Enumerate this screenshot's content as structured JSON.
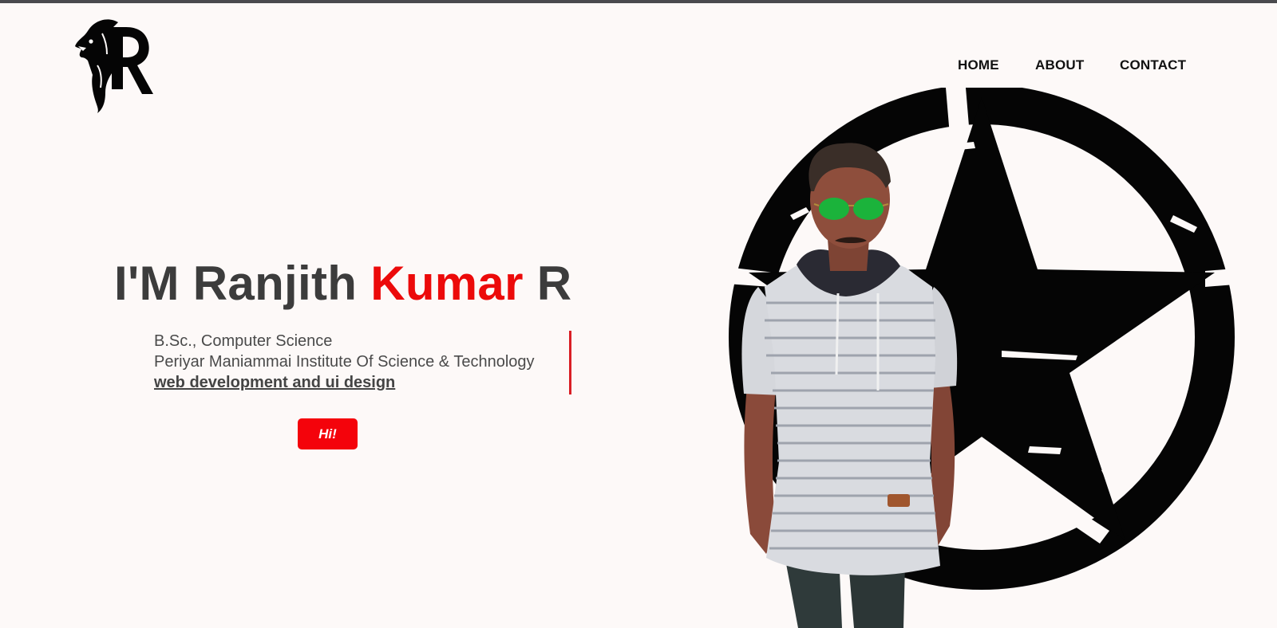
{
  "brand": {
    "logo_icon": "lion-r-logo-icon"
  },
  "nav": {
    "items": [
      {
        "label": "HOME"
      },
      {
        "label": "ABOUT"
      },
      {
        "label": "CONTACT"
      }
    ]
  },
  "hero": {
    "title_part1": "I'M Ranjith ",
    "title_accent": "Kumar",
    "title_part2": " R",
    "degree": "B.Sc., Computer Science",
    "institute": "Periyar Maniammai Institute Of Science & Technology",
    "skills": "web development and ui design",
    "cta_label": "Hi!"
  },
  "colors": {
    "accent": "#ec0a0a",
    "button": "#f4030b",
    "background": "#fdf9f8",
    "text": "#3c3c3c"
  },
  "images": {
    "portrait": "person-portrait-with-star-emblem"
  }
}
